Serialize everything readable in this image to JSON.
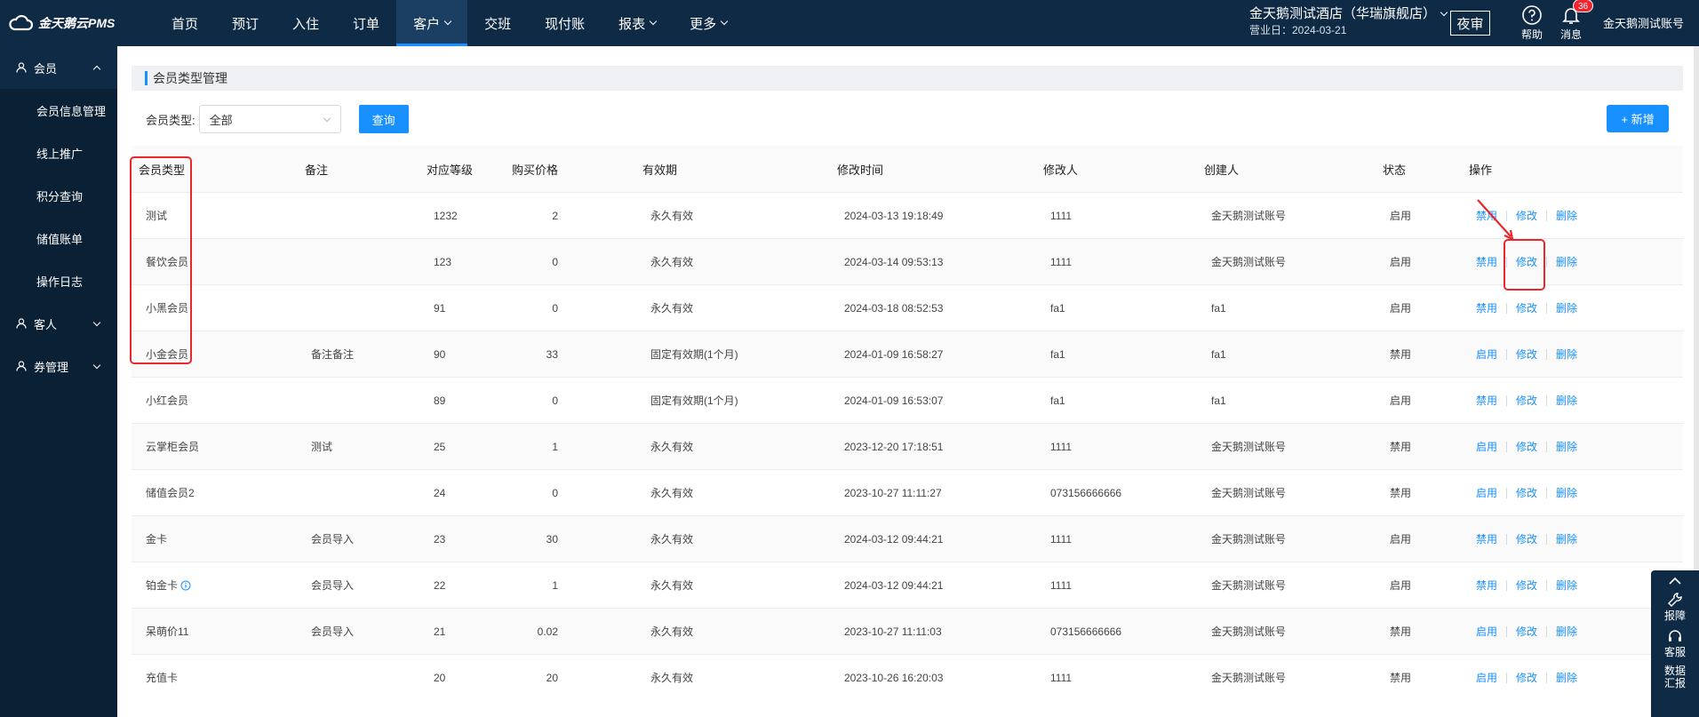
{
  "brand": {
    "name": "金天鹅云PMS"
  },
  "nav": [
    {
      "label": "首页",
      "dropdown": false,
      "active": false
    },
    {
      "label": "预订",
      "dropdown": false,
      "active": false
    },
    {
      "label": "入住",
      "dropdown": false,
      "active": false
    },
    {
      "label": "订单",
      "dropdown": false,
      "active": false
    },
    {
      "label": "客户",
      "dropdown": true,
      "active": true
    },
    {
      "label": "交班",
      "dropdown": false,
      "active": false
    },
    {
      "label": "现付账",
      "dropdown": false,
      "active": false
    },
    {
      "label": "报表",
      "dropdown": true,
      "active": false
    },
    {
      "label": "更多",
      "dropdown": true,
      "active": false
    }
  ],
  "hotel": {
    "name": "金天鹅测试酒店（华瑞旗舰店）",
    "business_day": "营业日：2024-03-21"
  },
  "night_audit": "夜审",
  "help": "帮助",
  "messages": {
    "label": "消息",
    "count": "36"
  },
  "account": "金天鹅测试账号",
  "sidebar": {
    "groups": [
      {
        "label": "会员",
        "icon": "user-icon",
        "open": true,
        "items": [
          "会员信息管理",
          "线上推广",
          "积分查询",
          "储值账单",
          "操作日志"
        ]
      },
      {
        "label": "客人",
        "icon": "user-icon",
        "open": false,
        "items": []
      },
      {
        "label": "券管理",
        "icon": "user-icon",
        "open": false,
        "items": []
      }
    ]
  },
  "page": {
    "title": "会员类型管理",
    "filter_label": "会员类型:",
    "filter_value": "全部",
    "query": "查询",
    "add": "+ 新增"
  },
  "table": {
    "headers": [
      "会员类型",
      "备注",
      "对应等级",
      "购买价格",
      "有效期",
      "修改时间",
      "修改人",
      "创建人",
      "状态",
      "操作"
    ],
    "rows": [
      {
        "type": "测试",
        "note": "",
        "level": "1232",
        "price": "2",
        "validity": "永久有效",
        "modified": "2024-03-13 19:18:49",
        "modifier": "1111",
        "creator": "金天鹅测试账号",
        "status": "启用",
        "toggle": "禁用"
      },
      {
        "type": "餐饮会员",
        "note": "",
        "level": "123",
        "price": "0",
        "validity": "永久有效",
        "modified": "2024-03-14 09:53:13",
        "modifier": "1111",
        "creator": "金天鹅测试账号",
        "status": "启用",
        "toggle": "禁用"
      },
      {
        "type": "小黑会员",
        "note": "",
        "level": "91",
        "price": "0",
        "validity": "永久有效",
        "modified": "2024-03-18 08:52:53",
        "modifier": "fa1",
        "creator": "fa1",
        "status": "启用",
        "toggle": "禁用"
      },
      {
        "type": "小金会员",
        "note": "备注备注",
        "level": "90",
        "price": "33",
        "validity": "固定有效期(1个月)",
        "modified": "2024-01-09 16:58:27",
        "modifier": "fa1",
        "creator": "fa1",
        "status": "禁用",
        "toggle": "启用"
      },
      {
        "type": "小红会员",
        "note": "",
        "level": "89",
        "price": "0",
        "validity": "固定有效期(1个月)",
        "modified": "2024-01-09 16:53:07",
        "modifier": "fa1",
        "creator": "fa1",
        "status": "启用",
        "toggle": "禁用"
      },
      {
        "type": "云掌柜会员",
        "note": "测试",
        "level": "25",
        "price": "1",
        "validity": "永久有效",
        "modified": "2023-12-20 17:18:51",
        "modifier": "1111",
        "creator": "金天鹅测试账号",
        "status": "禁用",
        "toggle": "启用"
      },
      {
        "type": "储值会员2",
        "note": "",
        "level": "24",
        "price": "0",
        "validity": "永久有效",
        "modified": "2023-10-27 11:11:27",
        "modifier": "073156666666",
        "creator": "金天鹅测试账号",
        "status": "禁用",
        "toggle": "启用"
      },
      {
        "type": "金卡",
        "note": "会员导入",
        "level": "23",
        "price": "30",
        "validity": "永久有效",
        "modified": "2024-03-12 09:44:21",
        "modifier": "1111",
        "creator": "金天鹅测试账号",
        "status": "启用",
        "toggle": "禁用"
      },
      {
        "type": "铂金卡",
        "note": "会员导入",
        "level": "22",
        "price": "1",
        "validity": "永久有效",
        "modified": "2024-03-12 09:44:21",
        "modifier": "1111",
        "creator": "金天鹅测试账号",
        "status": "启用",
        "toggle": "禁用",
        "info": true
      },
      {
        "type": "呆萌价11",
        "note": "会员导入",
        "level": "21",
        "price": "0.02",
        "validity": "永久有效",
        "modified": "2023-10-27 11:11:03",
        "modifier": "073156666666",
        "creator": "金天鹅测试账号",
        "status": "禁用",
        "toggle": "启用"
      },
      {
        "type": "充值卡",
        "note": "",
        "level": "20",
        "price": "20",
        "validity": "永久有效",
        "modified": "2023-10-26 16:20:03",
        "modifier": "1111",
        "creator": "金天鹅测试账号",
        "status": "禁用",
        "toggle": "启用"
      }
    ],
    "edit": "修改",
    "delete": "删除"
  },
  "float": {
    "repair": "报障",
    "service": "客服",
    "data": "数据汇报"
  },
  "colors": {
    "topbar": "#0f2a45",
    "sidebar": "#0a2035",
    "accent": "#1890ff",
    "annotation": "#e8262b"
  }
}
